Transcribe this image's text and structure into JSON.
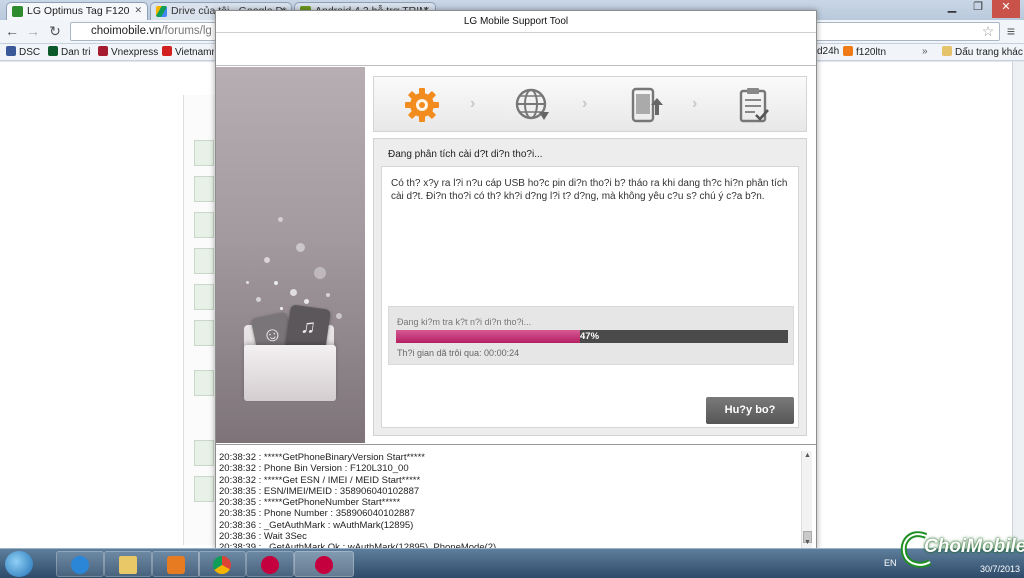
{
  "browser": {
    "tabs": [
      {
        "label": "LG Optimus Tag F120",
        "active": true
      },
      {
        "label": "Drive của tôi - Google Dr",
        "active": false
      },
      {
        "label": "Android 4.3 hỗ trợ TRIM",
        "active": false
      }
    ],
    "url_host": "choimobile.vn",
    "url_path": "/forums/lg",
    "bookmarks": [
      "DSC",
      "Dan tri",
      "Vnexpress",
      "Vietnamnet",
      "d24h",
      "f120ltn"
    ],
    "other_bookmarks": "Dấu trang khác"
  },
  "dialog": {
    "title": "LG Mobile Support Tool",
    "steps": [
      "settings-gear-icon",
      "globe-download-icon",
      "phone-upload-icon",
      "clipboard-check-icon"
    ],
    "status_heading": "Đang phân tích cài d?t di?n tho?i...",
    "message": "Có th? x?y ra l?i n?u cáp USB ho?c pin di?n tho?i b? tháo ra khi dang th?c hi?n phân tích cài d?t. Ði?n tho?i có th? kh?i d?ng l?i t? d?ng, mà không yêu c?u s? chú ý c?a b?n.",
    "progress": {
      "label": "Ðang ki?m tra k?t n?i di?n tho?i...",
      "percent": 47,
      "percent_text": "47%",
      "elapsed": "Th?i gian dã trôi qua: 00:00:24"
    },
    "cancel_label": "Hu?y bo?",
    "log": [
      "20:38:32 : *****GetPhoneBinaryVersion Start*****",
      "20:38:32 : Phone Bin Version : F120L310_00",
      "20:38:32 : *****Get ESN / IMEI / MEID Start*****",
      "20:38:35 : ESN/IMEI/MEID : 358906040102887",
      "20:38:35 : *****GetPhoneNumber Start*****",
      "20:38:35 : Phone Number : 358906040102887",
      "20:38:36 : _GetAuthMark : wAuthMark(12895)",
      "20:38:36 : Wait 3Sec",
      "20:38:39 : _GetAuthMark Ok : wAuthMark(12895), PhoneMode(2)"
    ]
  },
  "taskbar": {
    "language": "EN",
    "date": "30/7/2013"
  },
  "watermark": "ChoiMobile",
  "colors": {
    "progress_fill": "#c23372",
    "progress_track": "#4a4a4a",
    "cancel_button": "#666666",
    "step_active": "#f28c1e"
  }
}
